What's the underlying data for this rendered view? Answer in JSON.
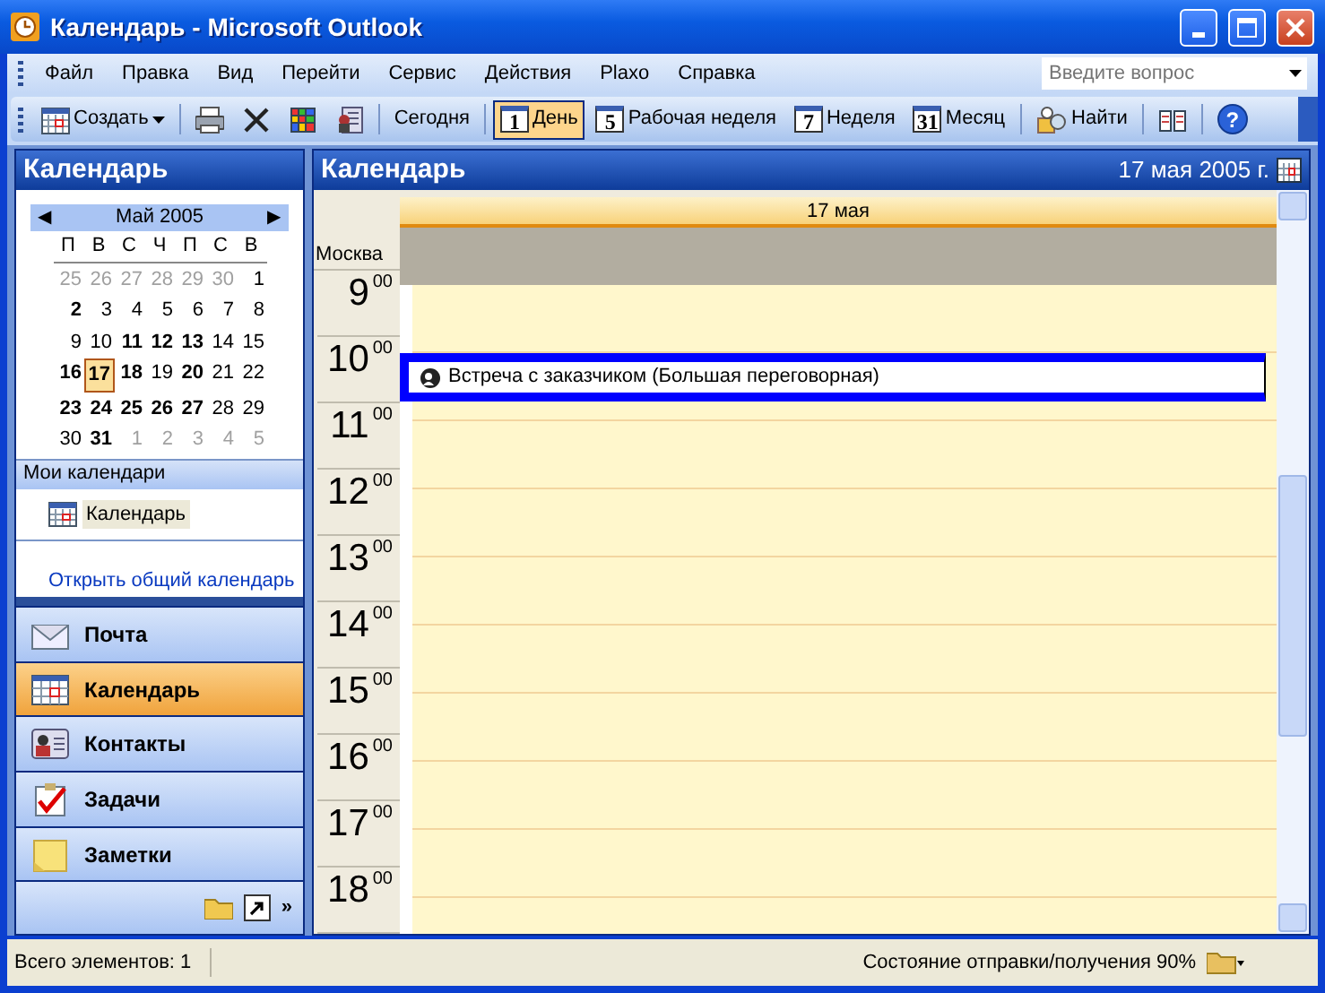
{
  "window": {
    "title": "Календарь - Microsoft Outlook"
  },
  "menu": [
    {
      "label": "Файл"
    },
    {
      "label": "Правка"
    },
    {
      "label": "Вид"
    },
    {
      "label": "Перейти"
    },
    {
      "label": "Сервис"
    },
    {
      "label": "Действия"
    },
    {
      "label": "Plaxo"
    },
    {
      "label": "Справка"
    }
  ],
  "help_search": {
    "placeholder": "Введите вопрос"
  },
  "toolbar": [
    {
      "kind": "new",
      "label": "Создать"
    },
    {
      "kind": "separator"
    },
    {
      "kind": "print"
    },
    {
      "kind": "delete"
    },
    {
      "kind": "grid"
    },
    {
      "kind": "card"
    },
    {
      "kind": "separator"
    },
    {
      "kind": "text",
      "label": "Сегодня"
    },
    {
      "kind": "separator"
    },
    {
      "kind": "view",
      "digit": "1",
      "label": "День",
      "selected": true
    },
    {
      "kind": "view",
      "digit": "5",
      "label": "Рабочая неделя",
      "selected": false
    },
    {
      "kind": "view",
      "digit": "7",
      "label": "Неделя",
      "selected": false
    },
    {
      "kind": "view",
      "digit": "31",
      "label": "Месяц",
      "selected": false
    },
    {
      "kind": "separator"
    },
    {
      "kind": "find",
      "label": "Найти"
    },
    {
      "kind": "separator"
    },
    {
      "kind": "book"
    },
    {
      "kind": "separator"
    },
    {
      "kind": "help",
      "glyph": "?"
    }
  ],
  "navigation_pane": {
    "title": "Календарь",
    "mini_calendar": {
      "month": "Май 2005",
      "prev": "◀",
      "next": "▶",
      "weekdays": [
        "П",
        "В",
        "С",
        "Ч",
        "П",
        "С",
        "В"
      ],
      "weeks": [
        [
          {
            "day": "25",
            "bold": false,
            "other_month": true,
            "selected": false
          },
          {
            "day": "26",
            "bold": false,
            "other_month": true,
            "selected": false
          },
          {
            "day": "27",
            "bold": false,
            "other_month": true,
            "selected": false
          },
          {
            "day": "28",
            "bold": false,
            "other_month": true,
            "selected": false
          },
          {
            "day": "29",
            "bold": false,
            "other_month": true,
            "selected": false
          },
          {
            "day": "30",
            "bold": false,
            "other_month": true,
            "selected": false
          },
          {
            "day": "1",
            "bold": false,
            "other_month": false,
            "selected": false
          }
        ],
        [
          {
            "day": "2",
            "bold": true,
            "other_month": false,
            "selected": false
          },
          {
            "day": "3",
            "bold": false,
            "other_month": false,
            "selected": false
          },
          {
            "day": "4",
            "bold": false,
            "other_month": false,
            "selected": false
          },
          {
            "day": "5",
            "bold": false,
            "other_month": false,
            "selected": false
          },
          {
            "day": "6",
            "bold": false,
            "other_month": false,
            "selected": false
          },
          {
            "day": "7",
            "bold": false,
            "other_month": false,
            "selected": false
          },
          {
            "day": "8",
            "bold": false,
            "other_month": false,
            "selected": false
          }
        ],
        [
          {
            "day": "9",
            "bold": false,
            "other_month": false,
            "selected": false
          },
          {
            "day": "10",
            "bold": false,
            "other_month": false,
            "selected": false
          },
          {
            "day": "11",
            "bold": true,
            "other_month": false,
            "selected": false
          },
          {
            "day": "12",
            "bold": true,
            "other_month": false,
            "selected": false
          },
          {
            "day": "13",
            "bold": true,
            "other_month": false,
            "selected": false
          },
          {
            "day": "14",
            "bold": false,
            "other_month": false,
            "selected": false
          },
          {
            "day": "15",
            "bold": false,
            "other_month": false,
            "selected": false
          }
        ],
        [
          {
            "day": "16",
            "bold": true,
            "other_month": false,
            "selected": false
          },
          {
            "day": "17",
            "bold": true,
            "other_month": false,
            "selected": true
          },
          {
            "day": "18",
            "bold": true,
            "other_month": false,
            "selected": false
          },
          {
            "day": "19",
            "bold": false,
            "other_month": false,
            "selected": false
          },
          {
            "day": "20",
            "bold": true,
            "other_month": false,
            "selected": false
          },
          {
            "day": "21",
            "bold": false,
            "other_month": false,
            "selected": false
          },
          {
            "day": "22",
            "bold": false,
            "other_month": false,
            "selected": false
          }
        ],
        [
          {
            "day": "23",
            "bold": true,
            "other_month": false,
            "selected": false
          },
          {
            "day": "24",
            "bold": true,
            "other_month": false,
            "selected": false
          },
          {
            "day": "25",
            "bold": true,
            "other_month": false,
            "selected": false
          },
          {
            "day": "26",
            "bold": true,
            "other_month": false,
            "selected": false
          },
          {
            "day": "27",
            "bold": true,
            "other_month": false,
            "selected": false
          },
          {
            "day": "28",
            "bold": false,
            "other_month": false,
            "selected": false
          },
          {
            "day": "29",
            "bold": false,
            "other_month": false,
            "selected": false
          }
        ],
        [
          {
            "day": "30",
            "bold": false,
            "other_month": false,
            "selected": false
          },
          {
            "day": "31",
            "bold": true,
            "other_month": false,
            "selected": false
          },
          {
            "day": "1",
            "bold": false,
            "other_month": true,
            "selected": false
          },
          {
            "day": "2",
            "bold": false,
            "other_month": true,
            "selected": false
          },
          {
            "day": "3",
            "bold": false,
            "other_month": true,
            "selected": false
          },
          {
            "day": "4",
            "bold": false,
            "other_month": true,
            "selected": false
          },
          {
            "day": "5",
            "bold": false,
            "other_month": true,
            "selected": false
          }
        ]
      ]
    },
    "my_calendars": {
      "title": "Мои календари",
      "items": [
        {
          "label": "Календарь",
          "selected": true
        }
      ]
    },
    "open_shared_link": "Открыть общий календарь",
    "nav_buttons": [
      {
        "kind": "mail",
        "label": "Почта",
        "selected": false
      },
      {
        "kind": "calendar",
        "label": "Календарь",
        "selected": true
      },
      {
        "kind": "contacts",
        "label": "Контакты",
        "selected": false
      },
      {
        "kind": "tasks",
        "label": "Задачи",
        "selected": false
      },
      {
        "kind": "notes",
        "label": "Заметки",
        "selected": false
      }
    ],
    "bottom_more": "»"
  },
  "day_view": {
    "title": "Календарь",
    "date": "17 мая 2005 г.",
    "day_header": "17 мая",
    "time_zone": "Москва",
    "hours": [
      {
        "hour": "9",
        "minutes": "00"
      },
      {
        "hour": "10",
        "minutes": "00"
      },
      {
        "hour": "11",
        "minutes": "00"
      },
      {
        "hour": "12",
        "minutes": "00"
      },
      {
        "hour": "13",
        "minutes": "00"
      },
      {
        "hour": "14",
        "minutes": "00"
      },
      {
        "hour": "15",
        "minutes": "00"
      },
      {
        "hour": "16",
        "minutes": "00"
      },
      {
        "hour": "17",
        "minutes": "00"
      },
      {
        "hour": "18",
        "minutes": "00"
      }
    ],
    "appointments": [
      {
        "title": "Встреча с заказчиком (Большая переговорная)",
        "selected": true
      }
    ]
  },
  "status_bar": {
    "items_count": "Всего элементов: 1",
    "send_receive": "Состояние отправки/получения 90%"
  }
}
